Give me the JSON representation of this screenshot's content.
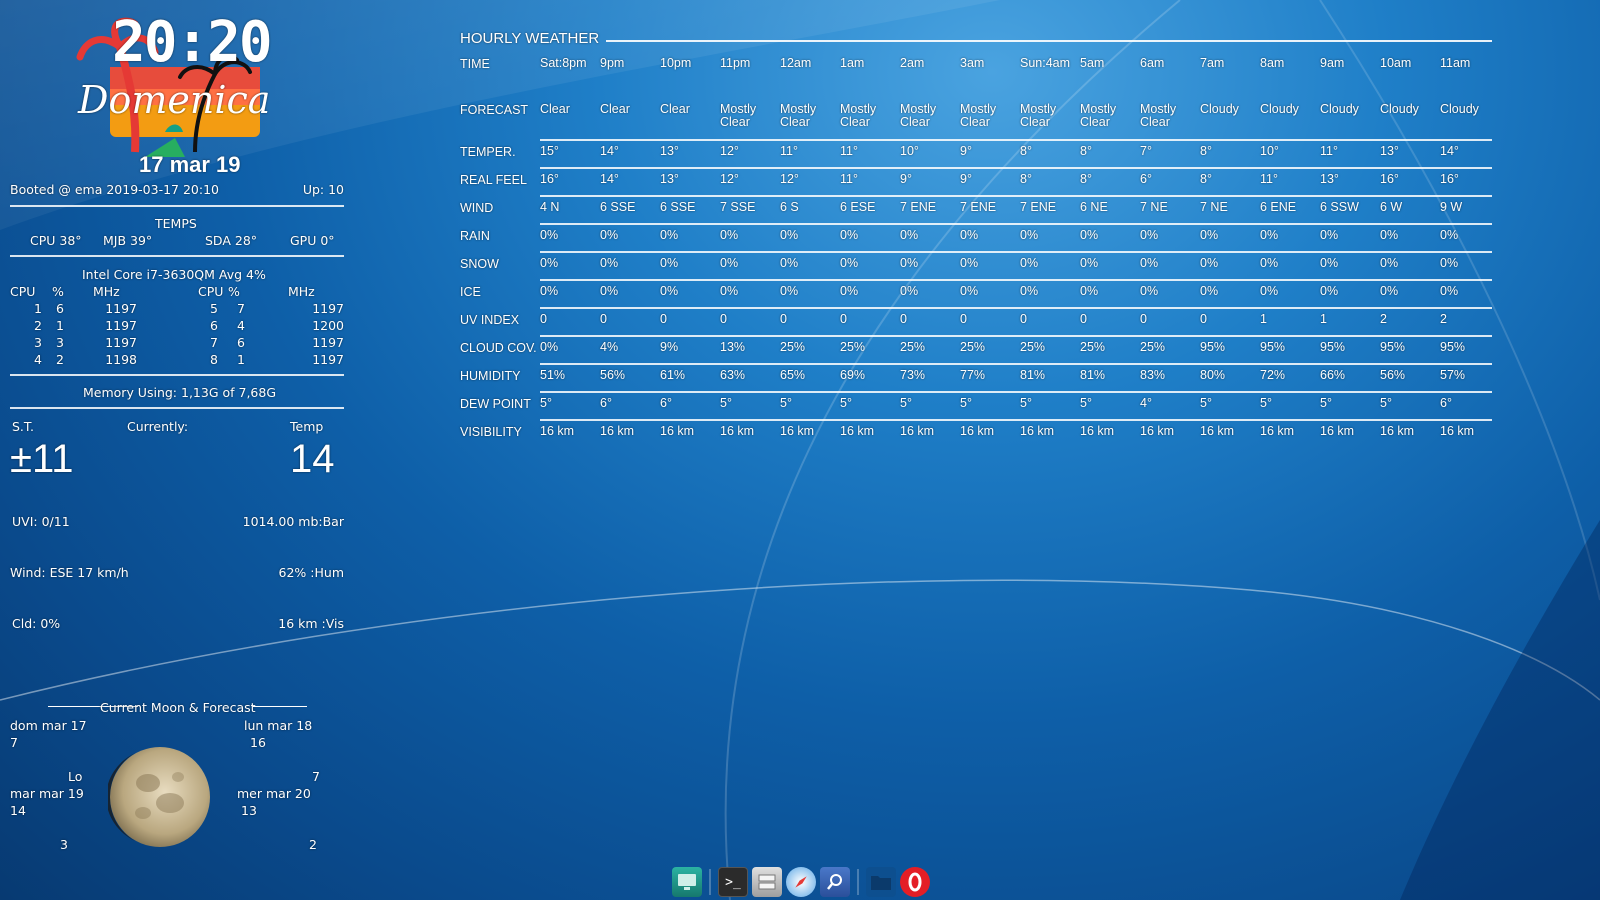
{
  "clock": {
    "time": "20:20",
    "day_name": "Domenica",
    "date": "17 mar 19"
  },
  "system": {
    "booted": "Booted @ ema 2019-03-17 20:10",
    "uptime": "Up: 10",
    "temps_title": "TEMPS",
    "temps": [
      "CPU 38°",
      "MJB 39°",
      "SDA 28°",
      "GPU 0°"
    ],
    "cpu_model": "Intel Core i7-3630QM Avg   4%",
    "cpu_headers": [
      "CPU",
      "%",
      "MHz",
      "CPU",
      "%",
      "MHz"
    ],
    "cpu_rows": [
      [
        "1",
        "6",
        "1197",
        "5",
        "7",
        "1197"
      ],
      [
        "2",
        "1",
        "1197",
        "6",
        "4",
        "1200"
      ],
      [
        "3",
        "3",
        "1197",
        "7",
        "6",
        "1197"
      ],
      [
        "4",
        "2",
        "1198",
        "8",
        "1",
        "1197"
      ]
    ],
    "memory": "Memory  Using: 1,13G of 7,68G"
  },
  "current_weather": {
    "st_label": "S.T.",
    "currently_label": "Currently:",
    "temp_label": "Temp",
    "st_value": "±11",
    "temp_value": "14",
    "uvi": "UVI: 0/11",
    "pressure": "1014.00 mb:Bar",
    "wind": "Wind: ESE 17 km/h",
    "humidity": "62% :Hum",
    "clouds": "Cld: 0%",
    "visibility": "16 km :Vis"
  },
  "moon": {
    "title": "Current Moon & Forecast",
    "days": [
      {
        "date": "dom mar 17",
        "value": "7"
      },
      {
        "date": "lun mar 18",
        "value": "16"
      },
      {
        "date": "mar mar 19",
        "value": "14"
      },
      {
        "date": "mer mar 20",
        "value": "13"
      }
    ],
    "lo_label": "Lo",
    "lo_value": "7",
    "bottom_left": "3",
    "bottom_right": "2"
  },
  "weather": {
    "title": "HOURLY WEATHER",
    "times": [
      "Sat:8pm",
      "9pm",
      "10pm",
      "11pm",
      "12am",
      "1am",
      "2am",
      "3am",
      "Sun:4am",
      "5am",
      "6am",
      "7am",
      "8am",
      "9am",
      "10am",
      "11am"
    ],
    "rows": [
      {
        "label": "FORECAST",
        "values": [
          "Clear",
          "Clear",
          "Clear",
          "Mostly Clear",
          "Mostly Clear",
          "Mostly Clear",
          "Mostly Clear",
          "Mostly Clear",
          "Mostly Clear",
          "Mostly Clear",
          "Mostly Clear",
          "Cloudy",
          "Cloudy",
          "Cloudy",
          "Cloudy",
          "Cloudy"
        ]
      },
      {
        "label": "TEMPER.",
        "values": [
          "15°",
          "14°",
          "13°",
          "12°",
          "11°",
          "11°",
          "10°",
          "9°",
          "8°",
          "8°",
          "7°",
          "8°",
          "10°",
          "11°",
          "13°",
          "14°"
        ]
      },
      {
        "label": "REAL FEEL",
        "values": [
          "16°",
          "14°",
          "13°",
          "12°",
          "12°",
          "11°",
          "9°",
          "9°",
          "8°",
          "8°",
          "6°",
          "8°",
          "11°",
          "13°",
          "16°",
          "16°"
        ]
      },
      {
        "label": "WIND",
        "values": [
          "4 N",
          "6 SSE",
          "6 SSE",
          "7 SSE",
          "6 S",
          "6 ESE",
          "7 ENE",
          "7 ENE",
          "7 ENE",
          "6 NE",
          "7 NE",
          "7 NE",
          "6 ENE",
          "6 SSW",
          "6 W",
          "9 W"
        ]
      },
      {
        "label": "RAIN",
        "values": [
          "0%",
          "0%",
          "0%",
          "0%",
          "0%",
          "0%",
          "0%",
          "0%",
          "0%",
          "0%",
          "0%",
          "0%",
          "0%",
          "0%",
          "0%",
          "0%"
        ]
      },
      {
        "label": "SNOW",
        "values": [
          "0%",
          "0%",
          "0%",
          "0%",
          "0%",
          "0%",
          "0%",
          "0%",
          "0%",
          "0%",
          "0%",
          "0%",
          "0%",
          "0%",
          "0%",
          "0%"
        ]
      },
      {
        "label": "ICE",
        "values": [
          "0%",
          "0%",
          "0%",
          "0%",
          "0%",
          "0%",
          "0%",
          "0%",
          "0%",
          "0%",
          "0%",
          "0%",
          "0%",
          "0%",
          "0%",
          "0%"
        ]
      },
      {
        "label": "UV INDEX",
        "values": [
          "0",
          "0",
          "0",
          "0",
          "0",
          "0",
          "0",
          "0",
          "0",
          "0",
          "0",
          "0",
          "1",
          "1",
          "2",
          "2"
        ]
      },
      {
        "label": "CLOUD COV.",
        "values": [
          "0%",
          "4%",
          "9%",
          "13%",
          "25%",
          "25%",
          "25%",
          "25%",
          "25%",
          "25%",
          "25%",
          "95%",
          "95%",
          "95%",
          "95%",
          "95%"
        ]
      },
      {
        "label": "HUMIDITY",
        "values": [
          "51%",
          "56%",
          "61%",
          "63%",
          "65%",
          "69%",
          "73%",
          "77%",
          "81%",
          "81%",
          "83%",
          "80%",
          "72%",
          "66%",
          "56%",
          "57%"
        ]
      },
      {
        "label": "DEW POINT",
        "values": [
          "5°",
          "6°",
          "6°",
          "5°",
          "5°",
          "5°",
          "5°",
          "5°",
          "5°",
          "5°",
          "4°",
          "5°",
          "5°",
          "5°",
          "5°",
          "6°"
        ]
      },
      {
        "label": "VISIBILITY",
        "values": [
          "16 km",
          "16 km",
          "16 km",
          "16 km",
          "16 km",
          "16 km",
          "16 km",
          "16 km",
          "16 km",
          "16 km",
          "16 km",
          "16 km",
          "16 km",
          "16 km",
          "16 km",
          "16 km"
        ]
      }
    ]
  },
  "dock": {
    "items": [
      {
        "name": "monitor-app-icon"
      },
      {
        "name": "terminal-icon"
      },
      {
        "name": "file-manager-icon"
      },
      {
        "name": "safari-compass-icon"
      },
      {
        "name": "search-icon"
      },
      {
        "name": "folder-icon"
      },
      {
        "name": "opera-icon"
      }
    ]
  }
}
